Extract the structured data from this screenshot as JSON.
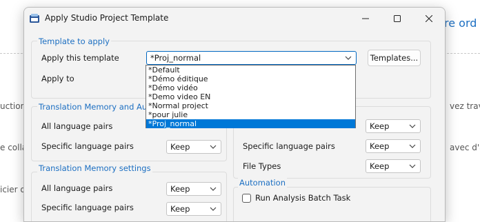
{
  "background": {
    "heading_fragment": "re ord",
    "left_fragments": [
      "uction",
      "e colla",
      "icier d"
    ],
    "right_fragments": [
      "vez trava",
      "avec d'a"
    ]
  },
  "dialog": {
    "title": "Apply Studio Project Template",
    "window_controls": {
      "minimize": "—",
      "maximize": "☐",
      "close": "✕"
    }
  },
  "template_group": {
    "title": "Template to apply",
    "apply_template_label": "Apply this template",
    "apply_template_value": "*Proj_normal",
    "templates_button": "Templates...",
    "apply_to_label": "Apply to",
    "dropdown_options": [
      "*Default",
      "*Démo éditique",
      "*Démo vidéo",
      "*Demo video EN",
      "*Normal project",
      "*pour julie",
      "*Proj_normal"
    ],
    "selected_option_index": 6
  },
  "tm_automated_group": {
    "title": "Translation Memory and Automated",
    "rows": [
      {
        "label": "All language pairs",
        "value": ""
      },
      {
        "label": "Specific language pairs",
        "value": "Keep"
      }
    ]
  },
  "tm_settings_group": {
    "title": "Translation Memory settings",
    "rows": [
      {
        "label": "All language pairs",
        "value": "Keep"
      },
      {
        "label": "Specific language pairs",
        "value": "Keep"
      }
    ]
  },
  "right_group": {
    "rows": [
      {
        "label": "",
        "value": "Keep"
      },
      {
        "label": "Specific language pairs",
        "value": "Keep"
      },
      {
        "label": "File Types",
        "value": "Keep"
      }
    ]
  },
  "automation_group": {
    "title": "Automation",
    "checkbox_label": "Run Analysis Batch Task"
  },
  "colors": {
    "accent": "#1c6fc2",
    "selection": "#0078d7"
  }
}
